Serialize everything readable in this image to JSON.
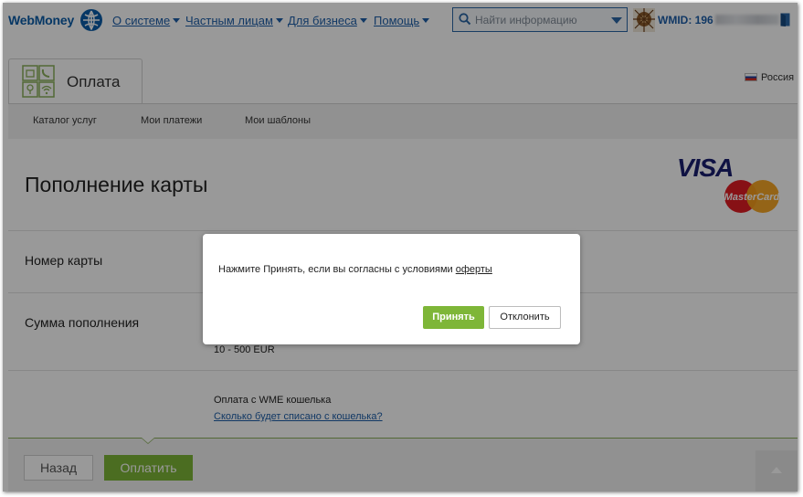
{
  "header": {
    "logo": "WebMoney",
    "nav": [
      {
        "label": "О системе"
      },
      {
        "label": "Частным лицам"
      },
      {
        "label": "Для бизнеса"
      },
      {
        "label": "Помощь"
      }
    ],
    "search_placeholder": "Найти информацию",
    "wmid_label": "WMID: 196",
    "icons": {
      "globe": "globe-icon",
      "search": "search-icon",
      "avatar": "avatar-icon",
      "exit": "exit-icon"
    }
  },
  "service": {
    "title": "Оплата",
    "region": "Россия",
    "tabs": [
      "Каталог услуг",
      "Мои платежи",
      "Мои шаблоны"
    ]
  },
  "page": {
    "title": "Пополнение карты",
    "brands": {
      "visa": "VISA",
      "mastercard": "MasterCard"
    },
    "card_number_label": "Номер карты",
    "amount_label": "Сумма пополнения",
    "amount_range": "10 - 500 EUR",
    "pay_from": "Оплата с WME кошелька",
    "how_much_link": "Сколько будет списано с кошелька?"
  },
  "footer": {
    "back_label": "Назад",
    "pay_label": "Оплатить"
  },
  "modal": {
    "text": "Нажмите Принять, если вы согласны с условиями ",
    "link": "оферты",
    "accept_label": "Принять",
    "decline_label": "Отклонить"
  },
  "colors": {
    "accent_green": "#7eb638",
    "link_blue": "#1d5ea8",
    "overlay": "rgba(0,0,0,0.40)"
  }
}
